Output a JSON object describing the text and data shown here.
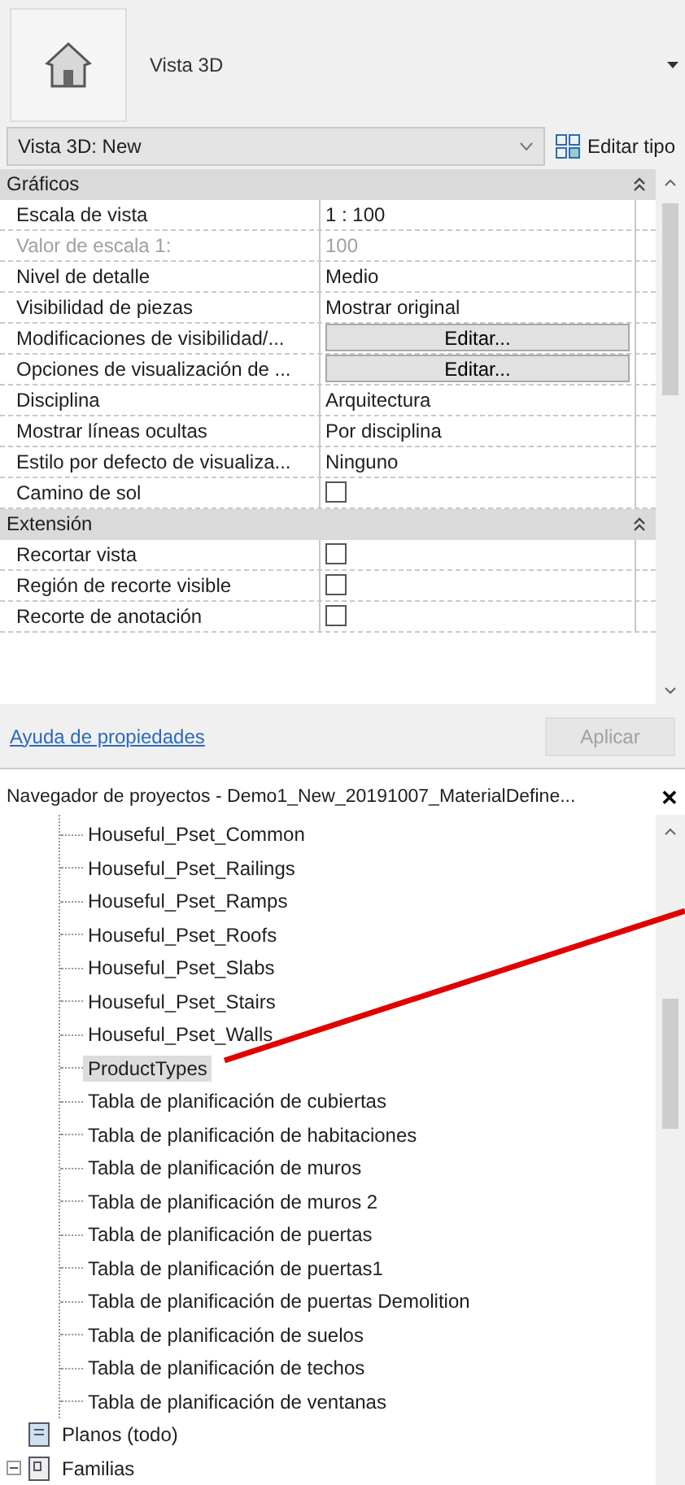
{
  "view_header": {
    "title": "Vista 3D"
  },
  "type_selector": {
    "value": "Vista 3D: New",
    "edit_type": "Editar tipo"
  },
  "sections": [
    {
      "title": "Gráficos",
      "expanded": true,
      "rows": [
        {
          "label": "Escala de vista",
          "kind": "text",
          "value": "1 : 100",
          "disabled": false
        },
        {
          "label": "Valor de escala    1:",
          "kind": "text",
          "value": "100",
          "disabled": true
        },
        {
          "label": "Nivel de detalle",
          "kind": "text",
          "value": "Medio",
          "disabled": false
        },
        {
          "label": "Visibilidad de piezas",
          "kind": "text",
          "value": "Mostrar original",
          "disabled": false
        },
        {
          "label": "Modificaciones de visibilidad/...",
          "kind": "button",
          "value": "Editar...",
          "disabled": false
        },
        {
          "label": "Opciones de visualización de ...",
          "kind": "button",
          "value": "Editar...",
          "disabled": false
        },
        {
          "label": "Disciplina",
          "kind": "text",
          "value": "Arquitectura",
          "disabled": false
        },
        {
          "label": "Mostrar líneas ocultas",
          "kind": "text",
          "value": "Por disciplina",
          "disabled": false
        },
        {
          "label": "Estilo por defecto de visualiza...",
          "kind": "text",
          "value": "Ninguno",
          "disabled": false
        },
        {
          "label": "Camino de sol",
          "kind": "checkbox",
          "checked": false,
          "disabled": false
        }
      ]
    },
    {
      "title": "Extensión",
      "expanded": true,
      "rows": [
        {
          "label": "Recortar vista",
          "kind": "checkbox",
          "checked": false,
          "disabled": false
        },
        {
          "label": "Región de recorte visible",
          "kind": "checkbox",
          "checked": false,
          "disabled": false
        },
        {
          "label": "Recorte de anotación",
          "kind": "checkbox",
          "checked": false,
          "disabled": false
        }
      ]
    }
  ],
  "properties_footer": {
    "help_link": "Ayuda de propiedades",
    "apply": "Aplicar",
    "apply_disabled": true
  },
  "project_browser": {
    "title": "Navegador de proyectos - Demo1_New_20191007_MaterialDefine...",
    "close": "✕",
    "items": [
      {
        "label": "Houseful_Pset_Common",
        "selected": false
      },
      {
        "label": "Houseful_Pset_Railings",
        "selected": false
      },
      {
        "label": "Houseful_Pset_Ramps",
        "selected": false
      },
      {
        "label": "Houseful_Pset_Roofs",
        "selected": false
      },
      {
        "label": "Houseful_Pset_Slabs",
        "selected": false
      },
      {
        "label": "Houseful_Pset_Stairs",
        "selected": false
      },
      {
        "label": "Houseful_Pset_Walls",
        "selected": false
      },
      {
        "label": "ProductTypes",
        "selected": true
      },
      {
        "label": "Tabla de planificación de cubiertas",
        "selected": false
      },
      {
        "label": "Tabla de planificación de habitaciones",
        "selected": false
      },
      {
        "label": "Tabla de planificación de muros",
        "selected": false
      },
      {
        "label": "Tabla de planificación de muros 2",
        "selected": false
      },
      {
        "label": "Tabla de planificación de puertas",
        "selected": false
      },
      {
        "label": "Tabla de planificación de puertas1",
        "selected": false
      },
      {
        "label": "Tabla de planificación de puertas Demolition",
        "selected": false
      },
      {
        "label": "Tabla de planificación de suelos",
        "selected": false
      },
      {
        "label": "Tabla de planificación de techos",
        "selected": false
      },
      {
        "label": "Tabla de planificación de ventanas",
        "selected": false
      }
    ],
    "roots": [
      {
        "label": "Planos (todo)",
        "kind": "sheets"
      },
      {
        "label": "Familias",
        "kind": "families",
        "expanded": true
      }
    ]
  }
}
